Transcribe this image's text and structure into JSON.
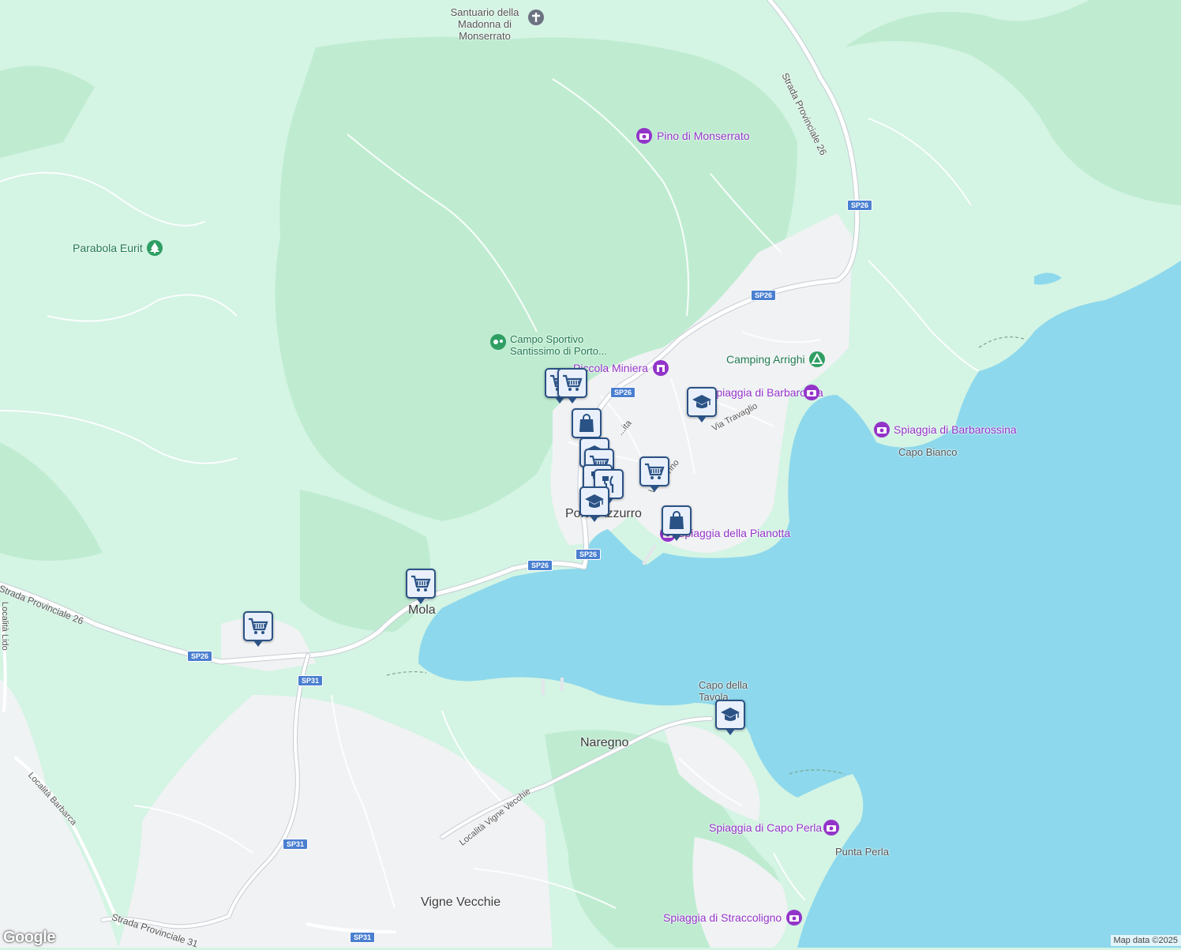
{
  "map": {
    "colors": {
      "land": "#d4f4e4",
      "forest": "#bfecd1",
      "water": "#8dd8ec",
      "urban": "#f1f2f4",
      "road": "#ffffff",
      "road_outline": "#c6ccd4",
      "pin_border": "#2a5285"
    },
    "places": {
      "porto_azzurro": "Porto Azzurro",
      "mola": "Mola",
      "naregno": "Naregno",
      "vigne_vecchie": "Vigne Vecchie",
      "capo_bianco": "Capo Bianco",
      "capo_della_tavola": "Capo della Tavola",
      "punta_perla": "Punta Perla"
    },
    "pois": {
      "santuario": "Santuario della Madonna di Monserrato",
      "pino": "Pino di Monserrato",
      "parabola": "Parabola Eurit",
      "campo_sportivo": "Campo Sportivo Santissimo di Porto...",
      "piccola_miniera": "Piccola Miniera",
      "camping": "Camping Arrighi",
      "barbarossa": "Spiaggia di Barbarossa",
      "barbarossina": "Spiaggia di Barbarossina",
      "pianotta": "Spiaggia della Pianotta",
      "capo_perla": "Spiaggia di Capo Perla",
      "straccoligno": "Spiaggia di Straccoligno"
    },
    "roads": {
      "sp26_full_a": "Strada Provinciale 26",
      "sp26_full_b": "Strada Provinciale 26",
      "sp31_full": "Strada Provinciale 31",
      "localita_lido": "Località Lido",
      "localita_barbarca": "Località Barbarca",
      "localita_vigne": "Località Vigne Vecchie",
      "via_travaglio": "Via Travaglio",
      "via_marino": "Via ...arino",
      "via_ita": "...ita"
    },
    "shields": {
      "sp26": "SP26",
      "sp31": "SP31"
    },
    "markers": [
      {
        "type": "cart-icon"
      },
      {
        "type": "cart-icon"
      },
      {
        "type": "bag-icon"
      },
      {
        "type": "school-icon"
      },
      {
        "type": "cart-icon"
      },
      {
        "type": "restaurant-icon"
      },
      {
        "type": "restaurant-icon"
      },
      {
        "type": "cart-icon"
      },
      {
        "type": "school-icon"
      },
      {
        "type": "bag-icon"
      },
      {
        "type": "school-icon"
      },
      {
        "type": "cart-icon"
      },
      {
        "type": "cart-icon"
      },
      {
        "type": "school-icon"
      }
    ],
    "google_logo": "Google",
    "attribution": "Map data ©2025"
  }
}
